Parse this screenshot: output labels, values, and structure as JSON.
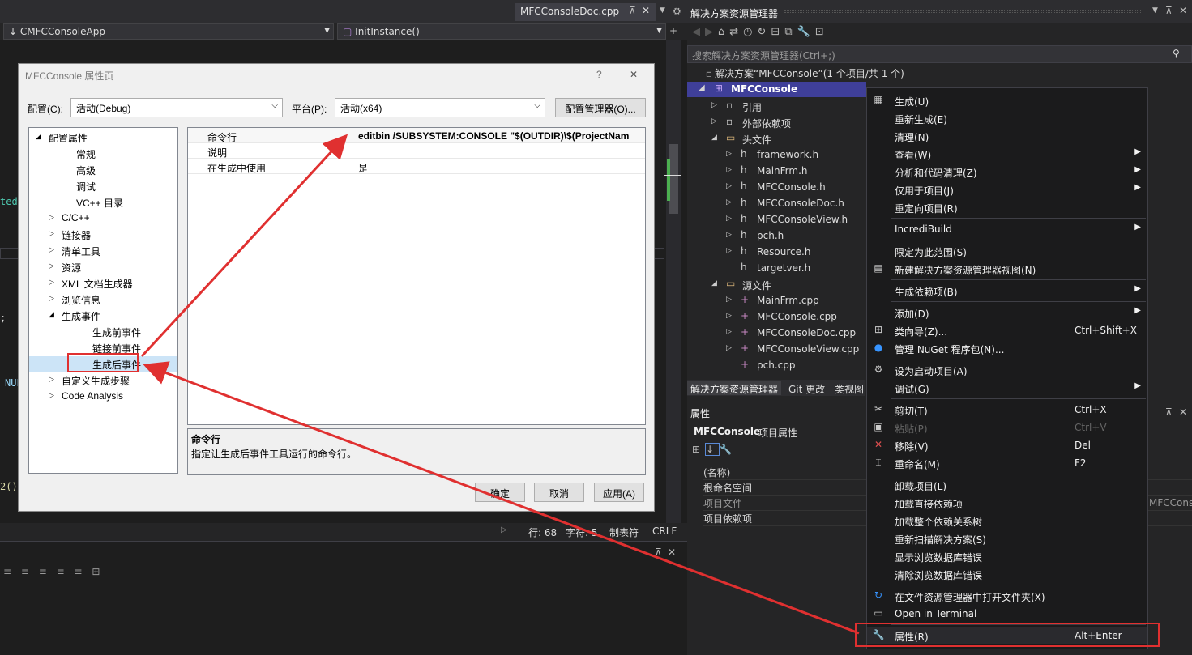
{
  "editor": {
    "doc_tab": "MFCConsoleDoc.cpp",
    "nav_class": "CMFCConsoleApp",
    "nav_method": "InitInstance()",
    "code_fragments": [
      "ted",
      ";",
      "NUL",
      "2()"
    ],
    "status": {
      "line": "行: 68",
      "char": "字符: 5",
      "tab": "制表符",
      "eol": "CRLF"
    }
  },
  "dialog": {
    "title": "MFCConsole 属性页",
    "help": "?",
    "close": "✕",
    "config_label": "配置(C):",
    "config_value": "活动(Debug)",
    "platform_label": "平台(P):",
    "platform_value": "活动(x64)",
    "config_manager": "配置管理器(O)...",
    "tree": [
      {
        "label": "配置属性",
        "level": 0,
        "exp": "◢"
      },
      {
        "label": "常规",
        "level": 2,
        "exp": ""
      },
      {
        "label": "高级",
        "level": 2,
        "exp": ""
      },
      {
        "label": "调试",
        "level": 2,
        "exp": ""
      },
      {
        "label": "VC++ 目录",
        "level": 2,
        "exp": ""
      },
      {
        "label": "C/C++",
        "level": 1,
        "exp": "▷"
      },
      {
        "label": "链接器",
        "level": 1,
        "exp": "▷"
      },
      {
        "label": "清单工具",
        "level": 1,
        "exp": "▷"
      },
      {
        "label": "资源",
        "level": 1,
        "exp": "▷"
      },
      {
        "label": "XML 文档生成器",
        "level": 1,
        "exp": "▷"
      },
      {
        "label": "浏览信息",
        "level": 1,
        "exp": "▷"
      },
      {
        "label": "生成事件",
        "level": 1,
        "exp": "◢"
      },
      {
        "label": "生成前事件",
        "level": 3,
        "exp": ""
      },
      {
        "label": "链接前事件",
        "level": 3,
        "exp": ""
      },
      {
        "label": "生成后事件",
        "level": 3,
        "exp": ""
      },
      {
        "label": "自定义生成步骤",
        "level": 1,
        "exp": "▷"
      },
      {
        "label": "Code Analysis",
        "level": 1,
        "exp": "▷"
      }
    ],
    "grid": [
      {
        "name": "命令行",
        "value": "editbin /SUBSYSTEM:CONSOLE \"$(OUTDIR)\\$(ProjectNam"
      },
      {
        "name": "说明",
        "value": ""
      },
      {
        "name": "在生成中使用",
        "value": "是"
      }
    ],
    "desc_title": "命令行",
    "desc_text": "指定让生成后事件工具运行的命令行。",
    "ok": "确定",
    "cancel": "取消",
    "apply": "应用(A)"
  },
  "solution": {
    "title": "解决方案资源管理器",
    "search_placeholder": "搜索解决方案资源管理器(Ctrl+;)",
    "root": "解决方案“MFCConsole”(1 个项目/共 1 个)",
    "project": "MFCConsole",
    "items": [
      {
        "label": "引用",
        "indent": 1,
        "icon": "▫",
        "exp": "▷"
      },
      {
        "label": "外部依赖项",
        "indent": 1,
        "icon": "▫",
        "exp": "▷"
      },
      {
        "label": "头文件",
        "indent": 1,
        "icon": "▭",
        "exp": "◢"
      },
      {
        "label": "framework.h",
        "indent": 2,
        "icon": "h",
        "exp": "▷"
      },
      {
        "label": "MainFrm.h",
        "indent": 2,
        "icon": "h",
        "exp": "▷"
      },
      {
        "label": "MFCConsole.h",
        "indent": 2,
        "icon": "h",
        "exp": "▷"
      },
      {
        "label": "MFCConsoleDoc.h",
        "indent": 2,
        "icon": "h",
        "exp": "▷"
      },
      {
        "label": "MFCConsoleView.h",
        "indent": 2,
        "icon": "h",
        "exp": "▷"
      },
      {
        "label": "pch.h",
        "indent": 2,
        "icon": "h",
        "exp": "▷"
      },
      {
        "label": "Resource.h",
        "indent": 2,
        "icon": "h",
        "exp": "▷"
      },
      {
        "label": "targetver.h",
        "indent": 2,
        "icon": "h",
        "exp": ""
      },
      {
        "label": "源文件",
        "indent": 1,
        "icon": "▭",
        "exp": "◢"
      },
      {
        "label": "MainFrm.cpp",
        "indent": 2,
        "icon": "+",
        "exp": "▷"
      },
      {
        "label": "MFCConsole.cpp",
        "indent": 2,
        "icon": "+",
        "exp": "▷"
      },
      {
        "label": "MFCConsoleDoc.cpp",
        "indent": 2,
        "icon": "+",
        "exp": "▷"
      },
      {
        "label": "MFCConsoleView.cpp",
        "indent": 2,
        "icon": "+",
        "exp": "▷"
      },
      {
        "label": "pch.cpp",
        "indent": 2,
        "icon": "+",
        "exp": ""
      }
    ],
    "tabs": [
      "解决方案资源管理器",
      "Git 更改",
      "类视图"
    ],
    "props": {
      "title": "属性",
      "object": "MFCConsole",
      "object_type": "项目属性",
      "rows": [
        "(名称)",
        "根命名空间",
        "项目文件",
        "项目依赖项"
      ],
      "cut_value": "MFCCons"
    }
  },
  "menu": [
    {
      "label": "生成(U)",
      "shortcut": "",
      "sub": false,
      "icon": "▦",
      "disabled": false
    },
    {
      "label": "重新生成(E)",
      "shortcut": "",
      "sub": false,
      "icon": "",
      "disabled": false
    },
    {
      "label": "清理(N)",
      "shortcut": "",
      "sub": false,
      "icon": "",
      "disabled": false
    },
    {
      "label": "查看(W)",
      "shortcut": "",
      "sub": true,
      "icon": "",
      "disabled": false
    },
    {
      "label": "分析和代码清理(Z)",
      "shortcut": "",
      "sub": true,
      "icon": "",
      "disabled": false
    },
    {
      "label": "仅用于项目(J)",
      "shortcut": "",
      "sub": true,
      "icon": "",
      "disabled": false
    },
    {
      "label": "重定向项目(R)",
      "shortcut": "",
      "sub": false,
      "icon": "",
      "disabled": false
    },
    {
      "sep": true
    },
    {
      "label": "IncrediBuild",
      "shortcut": "",
      "sub": true,
      "icon": "",
      "disabled": false
    },
    {
      "sep": true
    },
    {
      "label": "限定为此范围(S)",
      "shortcut": "",
      "sub": false,
      "icon": "",
      "disabled": false
    },
    {
      "label": "新建解决方案资源管理器视图(N)",
      "shortcut": "",
      "sub": false,
      "icon": "▤",
      "disabled": false
    },
    {
      "sep": true
    },
    {
      "label": "生成依赖项(B)",
      "shortcut": "",
      "sub": true,
      "icon": "",
      "disabled": false
    },
    {
      "sep": true
    },
    {
      "label": "添加(D)",
      "shortcut": "",
      "sub": true,
      "icon": "",
      "disabled": false
    },
    {
      "label": "类向导(Z)...",
      "shortcut": "Ctrl+Shift+X",
      "sub": false,
      "icon": "⊞",
      "disabled": false
    },
    {
      "label": "管理 NuGet 程序包(N)...",
      "shortcut": "",
      "sub": false,
      "icon": "●",
      "disabled": false
    },
    {
      "sep": true
    },
    {
      "label": "设为启动项目(A)",
      "shortcut": "",
      "sub": false,
      "icon": "⚙",
      "disabled": false
    },
    {
      "label": "调试(G)",
      "shortcut": "",
      "sub": true,
      "icon": "",
      "disabled": false
    },
    {
      "sep": true
    },
    {
      "label": "剪切(T)",
      "shortcut": "Ctrl+X",
      "sub": false,
      "icon": "✂",
      "disabled": false
    },
    {
      "label": "粘贴(P)",
      "shortcut": "Ctrl+V",
      "sub": false,
      "icon": "▣",
      "disabled": true
    },
    {
      "label": "移除(V)",
      "shortcut": "Del",
      "sub": false,
      "icon": "✕",
      "disabled": false
    },
    {
      "label": "重命名(M)",
      "shortcut": "F2",
      "sub": false,
      "icon": "⌶",
      "disabled": false
    },
    {
      "sep": true
    },
    {
      "label": "卸载项目(L)",
      "shortcut": "",
      "sub": false,
      "icon": "",
      "disabled": false
    },
    {
      "label": "加载直接依赖项",
      "shortcut": "",
      "sub": false,
      "icon": "",
      "disabled": false
    },
    {
      "label": "加载整个依赖关系树",
      "shortcut": "",
      "sub": false,
      "icon": "",
      "disabled": false
    },
    {
      "label": "重新扫描解决方案(S)",
      "shortcut": "",
      "sub": false,
      "icon": "",
      "disabled": false
    },
    {
      "label": "显示浏览数据库错误",
      "shortcut": "",
      "sub": false,
      "icon": "",
      "disabled": false
    },
    {
      "label": "清除浏览数据库错误",
      "shortcut": "",
      "sub": false,
      "icon": "",
      "disabled": false
    },
    {
      "sep": true
    },
    {
      "label": "在文件资源管理器中打开文件夹(X)",
      "shortcut": "",
      "sub": false,
      "icon": "↻",
      "disabled": false
    },
    {
      "label": "Open in Terminal",
      "shortcut": "",
      "sub": false,
      "icon": "▭",
      "disabled": false
    },
    {
      "sep": true
    },
    {
      "label": "属性(R)",
      "shortcut": "Alt+Enter",
      "sub": false,
      "icon": "🔧",
      "disabled": false
    }
  ],
  "colors": {
    "annotation": "#e03030",
    "selection": "#3f3f99",
    "vs_purple": "#68217a"
  }
}
